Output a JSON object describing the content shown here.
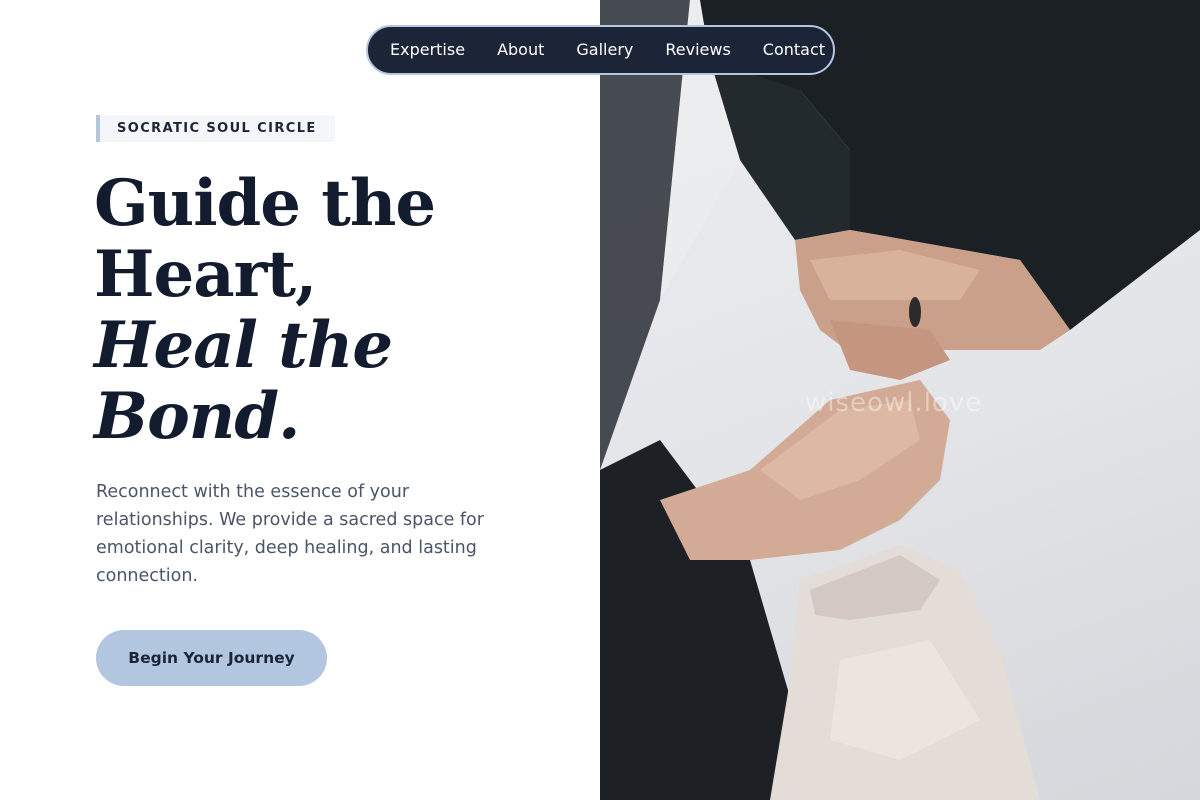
{
  "nav": {
    "items": [
      "Expertise",
      "About",
      "Gallery",
      "Reviews",
      "Contact"
    ]
  },
  "hero": {
    "eyebrow": "SOCRATIC SOUL CIRCLE",
    "headline": {
      "line1": "Guide the",
      "line2": "Heart,",
      "line3": "Heal the",
      "line4": "Bond."
    },
    "lede": "Reconnect with the essence of your relationships. We provide a sacred space for emotional clarity, deep healing, and lasting connection.",
    "cta_label": "Begin Your Journey"
  },
  "photo": {
    "subject": "hands-holding-image",
    "watermark": "wiseowl.love"
  },
  "colors": {
    "navy": "#1c2538",
    "accent": "#b3c6df",
    "text_muted": "#4a5568",
    "headline": "#131b2e"
  }
}
